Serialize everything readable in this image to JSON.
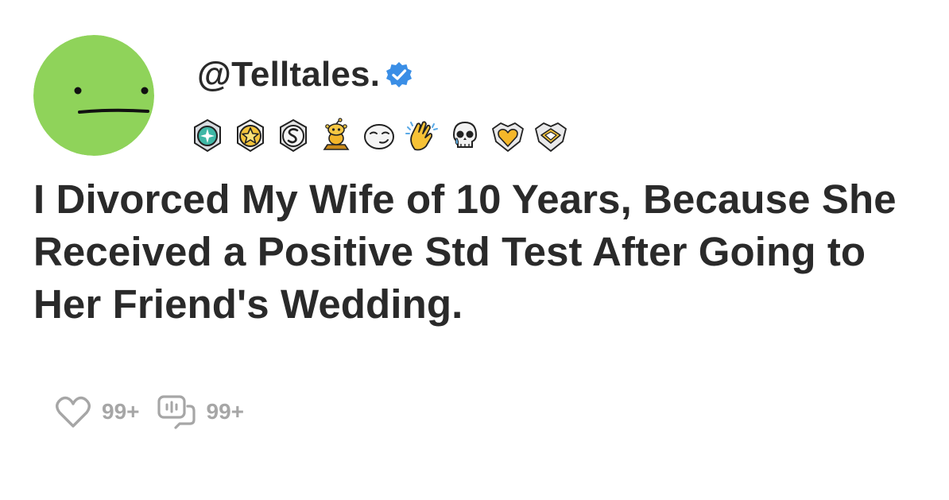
{
  "post": {
    "username": "@Telltales.",
    "verified": true,
    "title": "I Divorced My Wife of 10 Years, Because She Received a Positive Std Test After Going to Her Friend's Wedding.",
    "likes": "99+",
    "comments": "99+"
  },
  "awards": [
    "helpful-award-icon",
    "gold-star-award-icon",
    "silver-s-award-icon",
    "gold-snoo-award-icon",
    "smug-face-award-icon",
    "clapping-hands-award-icon",
    "skull-tears-award-icon",
    "gold-heart-shield-award-icon",
    "platinum-shield-award-icon"
  ],
  "colors": {
    "avatar": "#8fd35a",
    "text": "#2a2a2a",
    "muted": "#a6a6a6",
    "verified": "#3a8ee6"
  }
}
